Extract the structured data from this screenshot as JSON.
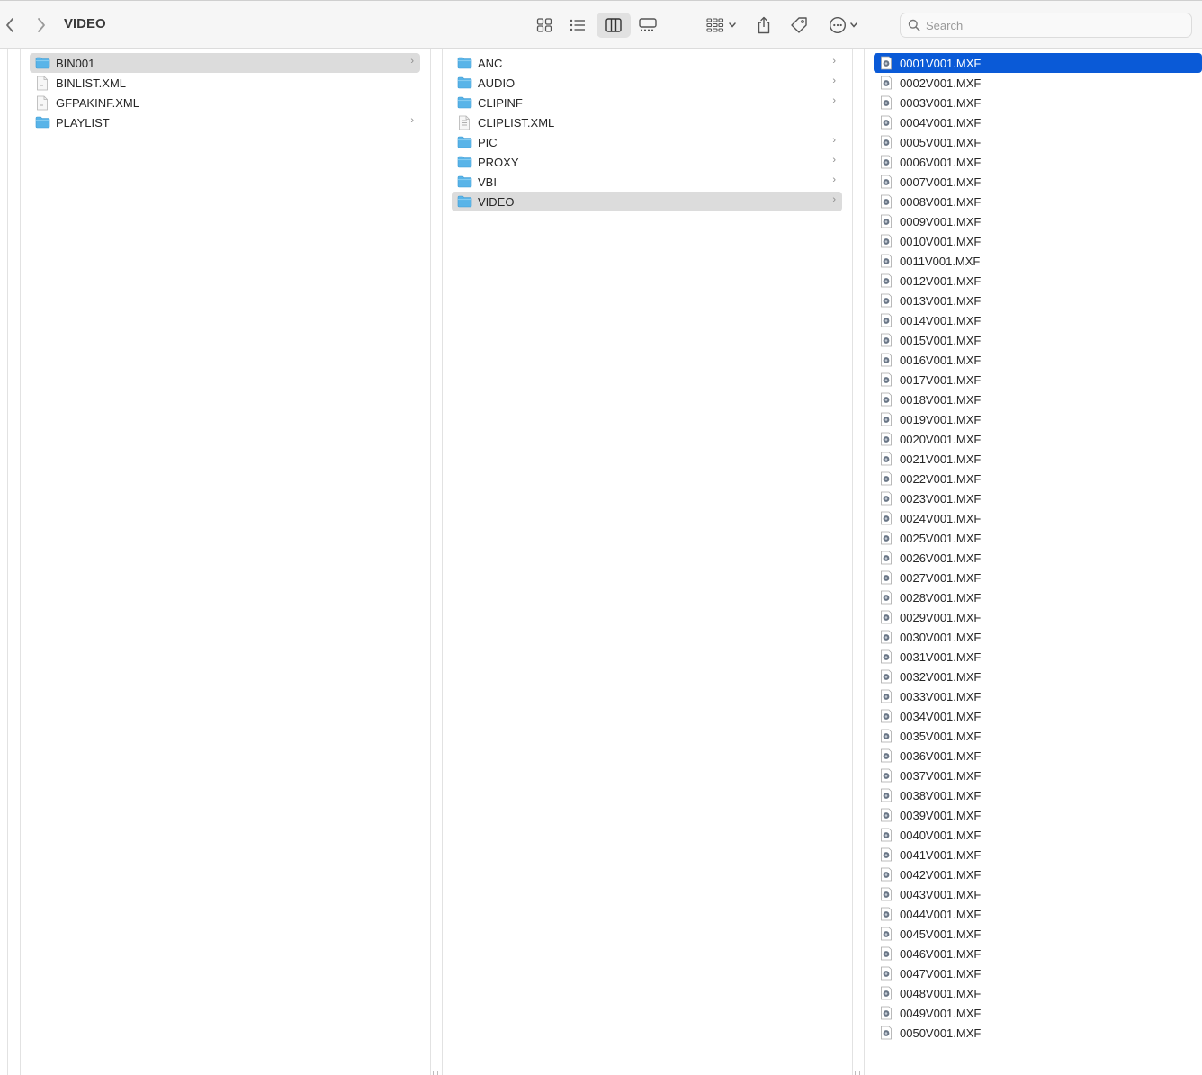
{
  "window": {
    "title": "VIDEO",
    "search_placeholder": "Search"
  },
  "toolbar": {
    "back_icon": "chevron-left-icon",
    "forward_icon": "chevron-right-icon",
    "view_modes": [
      "icon-view",
      "list-view",
      "column-view",
      "gallery-view"
    ],
    "active_view": "column-view",
    "group_icon": "group-grid-icon",
    "share_icon": "share-icon",
    "tag_icon": "tag-icon",
    "more_icon": "ellipsis-icon"
  },
  "colors": {
    "selection_blue": "#0a5ad7",
    "selection_gray": "#dcdcdc",
    "folder_blue": "#59b4e8"
  },
  "columns": [
    {
      "items": [
        {
          "name": "BIN001",
          "type": "folder",
          "selected": "gray",
          "has_children": true
        },
        {
          "name": "BINLIST.XML",
          "type": "file"
        },
        {
          "name": "GFPAKINF.XML",
          "type": "file"
        },
        {
          "name": "PLAYLIST",
          "type": "folder",
          "has_children": true
        }
      ]
    },
    {
      "items": [
        {
          "name": "ANC",
          "type": "folder",
          "has_children": true
        },
        {
          "name": "AUDIO",
          "type": "folder",
          "has_children": true
        },
        {
          "name": "CLIPINF",
          "type": "folder",
          "has_children": true
        },
        {
          "name": "CLIPLIST.XML",
          "type": "file"
        },
        {
          "name": "PIC",
          "type": "folder",
          "has_children": true
        },
        {
          "name": "PROXY",
          "type": "folder",
          "has_children": true
        },
        {
          "name": "VBI",
          "type": "folder",
          "has_children": true
        },
        {
          "name": "VIDEO",
          "type": "folder",
          "selected": "gray",
          "has_children": true
        }
      ]
    },
    {
      "items": [
        {
          "name": "0001V001.MXF",
          "type": "media",
          "selected": "blue"
        },
        {
          "name": "0002V001.MXF",
          "type": "media"
        },
        {
          "name": "0003V001.MXF",
          "type": "media"
        },
        {
          "name": "0004V001.MXF",
          "type": "media"
        },
        {
          "name": "0005V001.MXF",
          "type": "media"
        },
        {
          "name": "0006V001.MXF",
          "type": "media"
        },
        {
          "name": "0007V001.MXF",
          "type": "media"
        },
        {
          "name": "0008V001.MXF",
          "type": "media"
        },
        {
          "name": "0009V001.MXF",
          "type": "media"
        },
        {
          "name": "0010V001.MXF",
          "type": "media"
        },
        {
          "name": "0011V001.MXF",
          "type": "media"
        },
        {
          "name": "0012V001.MXF",
          "type": "media"
        },
        {
          "name": "0013V001.MXF",
          "type": "media"
        },
        {
          "name": "0014V001.MXF",
          "type": "media"
        },
        {
          "name": "0015V001.MXF",
          "type": "media"
        },
        {
          "name": "0016V001.MXF",
          "type": "media"
        },
        {
          "name": "0017V001.MXF",
          "type": "media"
        },
        {
          "name": "0018V001.MXF",
          "type": "media"
        },
        {
          "name": "0019V001.MXF",
          "type": "media"
        },
        {
          "name": "0020V001.MXF",
          "type": "media"
        },
        {
          "name": "0021V001.MXF",
          "type": "media"
        },
        {
          "name": "0022V001.MXF",
          "type": "media"
        },
        {
          "name": "0023V001.MXF",
          "type": "media"
        },
        {
          "name": "0024V001.MXF",
          "type": "media"
        },
        {
          "name": "0025V001.MXF",
          "type": "media"
        },
        {
          "name": "0026V001.MXF",
          "type": "media"
        },
        {
          "name": "0027V001.MXF",
          "type": "media"
        },
        {
          "name": "0028V001.MXF",
          "type": "media"
        },
        {
          "name": "0029V001.MXF",
          "type": "media"
        },
        {
          "name": "0030V001.MXF",
          "type": "media"
        },
        {
          "name": "0031V001.MXF",
          "type": "media"
        },
        {
          "name": "0032V001.MXF",
          "type": "media"
        },
        {
          "name": "0033V001.MXF",
          "type": "media"
        },
        {
          "name": "0034V001.MXF",
          "type": "media"
        },
        {
          "name": "0035V001.MXF",
          "type": "media"
        },
        {
          "name": "0036V001.MXF",
          "type": "media"
        },
        {
          "name": "0037V001.MXF",
          "type": "media"
        },
        {
          "name": "0038V001.MXF",
          "type": "media"
        },
        {
          "name": "0039V001.MXF",
          "type": "media"
        },
        {
          "name": "0040V001.MXF",
          "type": "media"
        },
        {
          "name": "0041V001.MXF",
          "type": "media"
        },
        {
          "name": "0042V001.MXF",
          "type": "media"
        },
        {
          "name": "0043V001.MXF",
          "type": "media"
        },
        {
          "name": "0044V001.MXF",
          "type": "media"
        },
        {
          "name": "0045V001.MXF",
          "type": "media"
        },
        {
          "name": "0046V001.MXF",
          "type": "media"
        },
        {
          "name": "0047V001.MXF",
          "type": "media"
        },
        {
          "name": "0048V001.MXF",
          "type": "media"
        },
        {
          "name": "0049V001.MXF",
          "type": "media"
        },
        {
          "name": "0050V001.MXF",
          "type": "media"
        }
      ]
    }
  ]
}
